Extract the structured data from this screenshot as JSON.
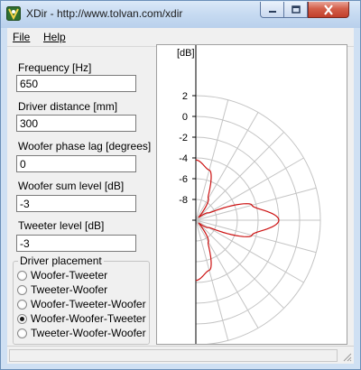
{
  "window": {
    "title": "XDir - http://www.tolvan.com/xdir"
  },
  "menu": {
    "file": "File",
    "help": "Help"
  },
  "fields": [
    {
      "label": "Frequency [Hz]",
      "value": "650"
    },
    {
      "label": "Driver distance [mm]",
      "value": "300"
    },
    {
      "label": "Woofer phase lag [degrees]",
      "value": "0"
    },
    {
      "label": "Woofer sum level [dB]",
      "value": "-3"
    },
    {
      "label": "Tweeter level [dB]",
      "value": "-3"
    }
  ],
  "placement": {
    "title": "Driver placement",
    "options": [
      "Woofer-Tweeter",
      "Tweeter-Woofer",
      "Woofer-Tweeter-Woofer",
      "Woofer-Woofer-Tweeter",
      "Tweeter-Woofer-Woofer"
    ],
    "selected": "Woofer-Woofer-Tweeter"
  },
  "chart_data": {
    "type": "polar",
    "ylabel": "[dB]",
    "tick_labels": [
      "2",
      "0",
      "-2",
      "-4",
      "-6",
      "-8"
    ],
    "rlim": [
      -10,
      2
    ],
    "ring_step_db": 2,
    "spoke_step_deg": 15,
    "grid": true,
    "curve_color": "#cc1111",
    "series": [
      {
        "angles_deg": [
          -90,
          -75,
          -60,
          -45,
          -30,
          -15,
          0,
          15,
          30,
          45,
          60,
          75,
          90
        ],
        "values_db": [
          -4.2,
          -5.0,
          -7.6,
          -9.6,
          -8.6,
          -4.4,
          -2.0,
          -4.4,
          -8.6,
          -9.6,
          -7.6,
          -5.0,
          -4.2
        ]
      }
    ]
  }
}
